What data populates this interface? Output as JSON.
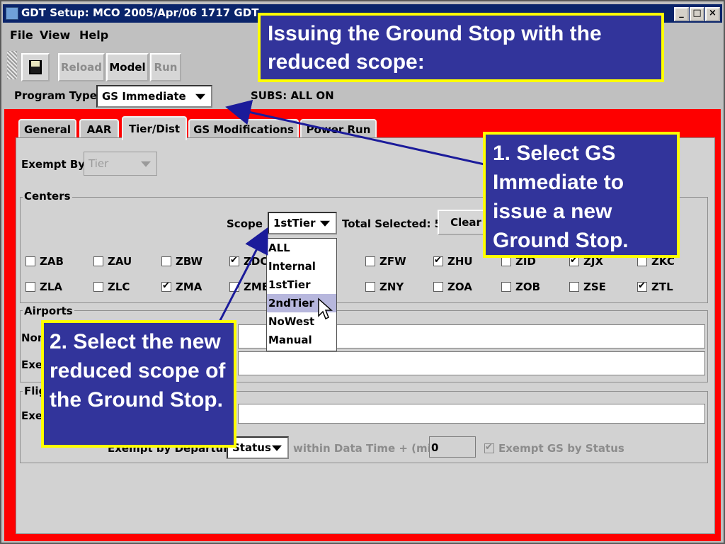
{
  "window": {
    "title": "GDT Setup: MCO 2005/Apr/06 1717 GDT",
    "buttons": [
      "_",
      "□",
      "×"
    ]
  },
  "menu": [
    "File",
    "View",
    "Help"
  ],
  "toolbar": {
    "reload": "Reload",
    "model": "Model",
    "run": "Run"
  },
  "program": {
    "label": "Program Type",
    "value": "GS Immediate",
    "subs": "SUBS:  ALL ON"
  },
  "tabs": [
    "General",
    "AAR",
    "Tier/Dist",
    "GS Modifications",
    "Power Run"
  ],
  "exempt_by": {
    "label": "Exempt By",
    "value": "Tier"
  },
  "centers": {
    "title": "Centers",
    "scope_label": "Scope",
    "scope_value": "1stTier",
    "total_selected": "Total Selected: 5",
    "clear": "Clear",
    "row1": [
      {
        "name": "ZAB",
        "checked": false
      },
      {
        "name": "ZAU",
        "checked": false
      },
      {
        "name": "ZBW",
        "checked": false
      },
      {
        "name": "ZDC",
        "checked": true
      },
      {
        "name": "ZFW",
        "checked": false
      },
      {
        "name": "ZHU",
        "checked": true
      },
      {
        "name": "ZID",
        "checked": false
      },
      {
        "name": "ZJX",
        "checked": true
      },
      {
        "name": "ZKC",
        "checked": false
      }
    ],
    "row2": [
      {
        "name": "ZLA",
        "checked": false
      },
      {
        "name": "ZLC",
        "checked": false
      },
      {
        "name": "ZMA",
        "checked": true
      },
      {
        "name": "ZME",
        "checked": false
      },
      {
        "name": "ZNY",
        "checked": false
      },
      {
        "name": "ZOA",
        "checked": false
      },
      {
        "name": "ZOB",
        "checked": false
      },
      {
        "name": "ZSE",
        "checked": false
      },
      {
        "name": "ZTL",
        "checked": true
      }
    ]
  },
  "scope_options": [
    "ALL",
    "Internal",
    "1stTier",
    "2ndTier",
    "NoWest",
    "Manual"
  ],
  "scope_highlight": "2ndTier",
  "airports": {
    "title": "Airports",
    "non_label": "Non",
    "exempt_label": "Exe"
  },
  "flights": {
    "title": "Flig",
    "exempt_label": "Exe",
    "departure_label": "Exempt by Departure",
    "status": "Status",
    "within": "within Data Time + (min)",
    "minutes": "0",
    "exempt_gs": "Exempt GS by Status"
  },
  "callouts": {
    "title": "Issuing the Ground Stop with the reduced scope:",
    "step1": "1. Select GS Immediate to issue a new Ground Stop.",
    "step2": "2. Select the new reduced scope of the Ground Stop."
  },
  "colors": {
    "callout_bg": "#32349b",
    "callout_border": "#ffff00",
    "red_panel": "#fe0000",
    "titlebar": "#0a246a",
    "arrow": "#1b1b9a"
  }
}
